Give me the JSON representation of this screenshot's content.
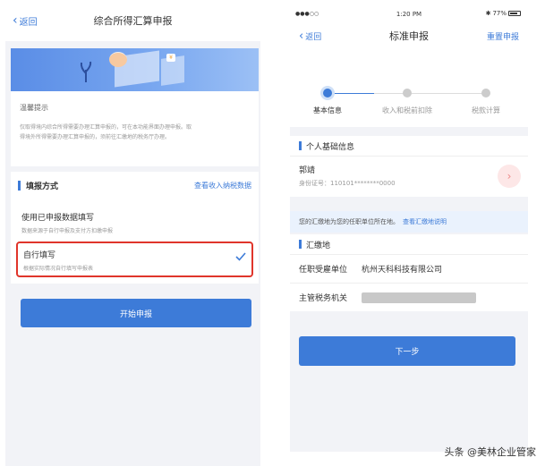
{
  "left": {
    "back_label": "返回",
    "title": "综合所得汇算申报",
    "banner_badge": "¥",
    "tip_title": "温馨提示",
    "tip_text_1": "仅取得境内综合所得需要办理汇算申报的，可在本功能界面办理申报。取",
    "tip_text_2": "得境外所得需要办理汇算申报的，须前往汇缴地的税务厅办理。",
    "section_label": "填报方式",
    "section_link": "查看收入纳税数据",
    "options": [
      {
        "title": "使用已申报数据填写",
        "subtitle": "数据来源于自行申报及支付方扣缴申报"
      },
      {
        "title": "自行填写",
        "subtitle": "根据实际情况自行填写申报表"
      }
    ],
    "start_button": "开始申报"
  },
  "right": {
    "status_signal": "●●●○○",
    "status_time": "1:20 PM",
    "status_battery": "77%",
    "battery_level": 0.77,
    "back_label": "返回",
    "title": "标准申报",
    "reset_label": "重置申报",
    "steps": [
      "基本信息",
      "收入和税前扣除",
      "税款计算"
    ],
    "active_step": 0,
    "personal_section": "个人基础信息",
    "person_name": "郭靖",
    "person_id": "身份证号：110101********0000",
    "info_text": "您的汇缴地为您的任职单位所在地。",
    "info_link": "查看汇缴地说明",
    "location_section": "汇缴地",
    "employer_label": "任职受雇单位",
    "employer_value": "杭州天科科技有限公司",
    "tax_office_label": "主管税务机关",
    "next_button": "下一步"
  },
  "watermark": "头条 @美林企业管家",
  "colors": {
    "accent": "#3d7bd8",
    "highlight": "#e0352b",
    "background": "#f2f3f7"
  }
}
